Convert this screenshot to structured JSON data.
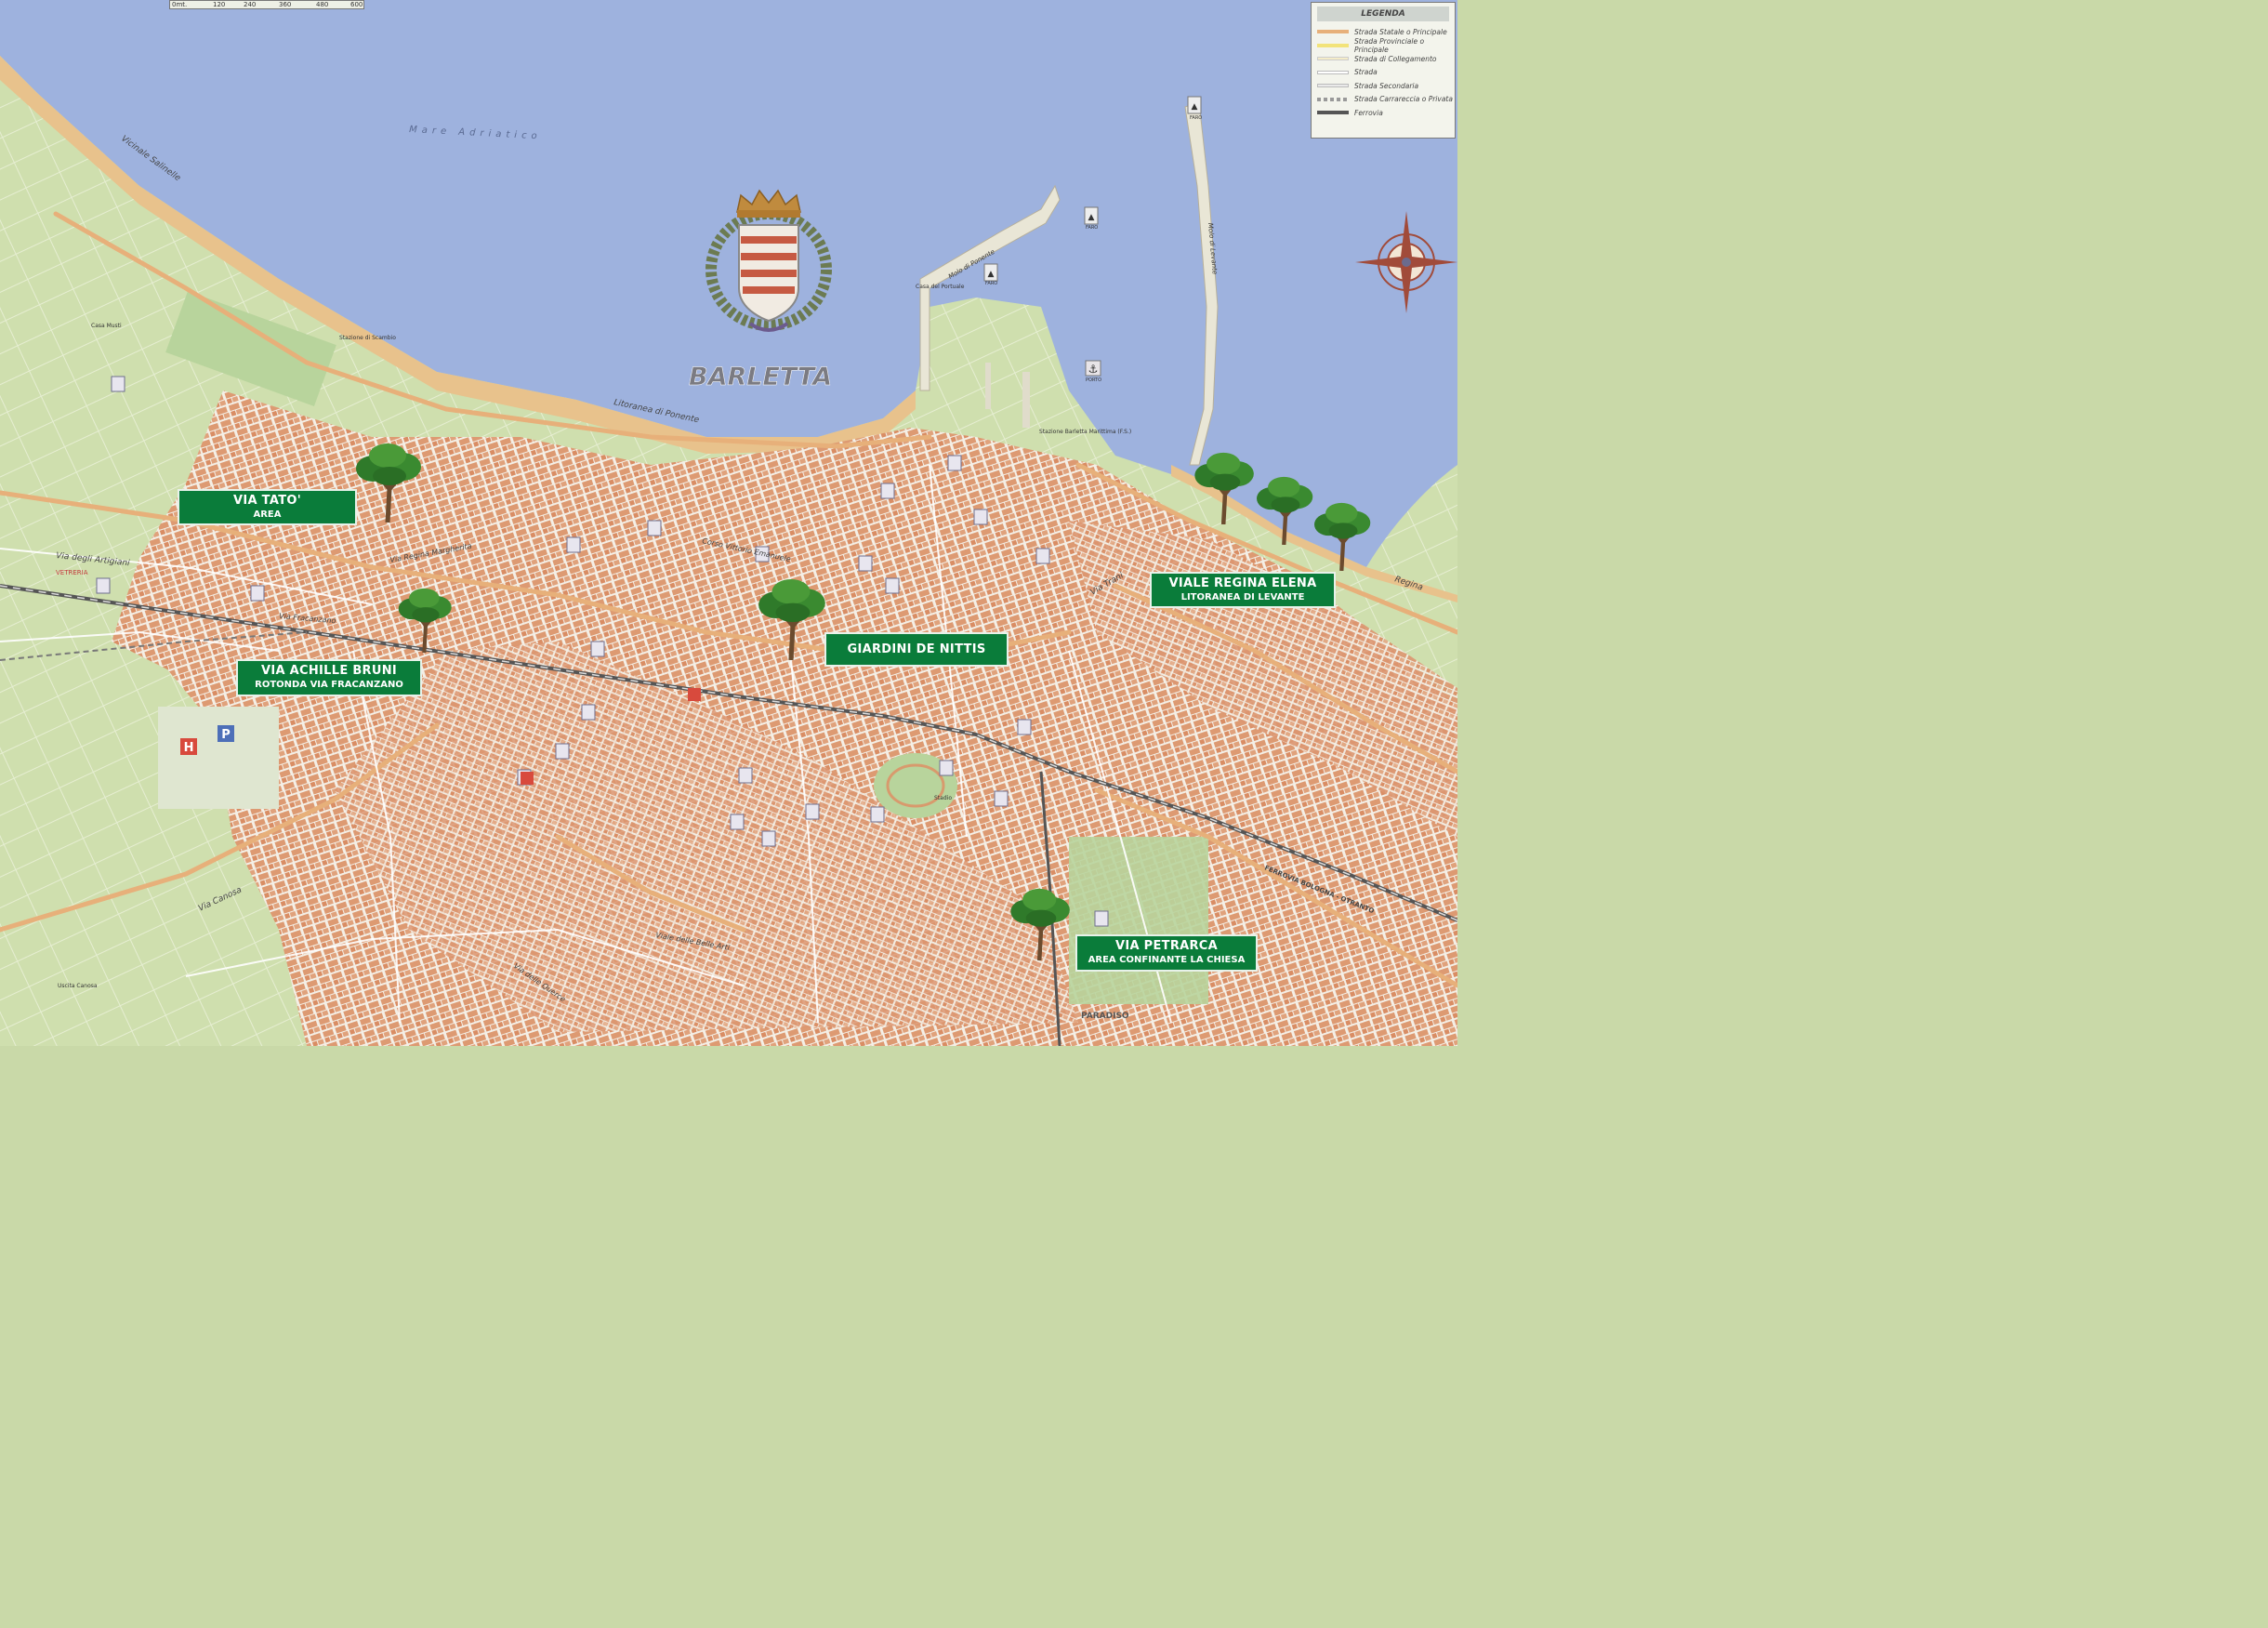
{
  "city_name": "BARLETTA",
  "sea_label": "Mare   Adriatico",
  "scale": {
    "unit": "0mt.",
    "ticks": [
      "120",
      "240",
      "360",
      "480",
      "600"
    ]
  },
  "legend": {
    "title": "LEGENDA",
    "items": [
      {
        "label": "Strada Statale o Principale",
        "color": "#e7b07a"
      },
      {
        "label": "Strada Provinciale o Principale",
        "color": "#f2e37a"
      },
      {
        "label": "Strada di Collegamento",
        "color": "#f4ecc8"
      },
      {
        "label": "Strada",
        "color": "#ffffff"
      },
      {
        "label": "Strada Secondaria",
        "color": "#e9e9e9"
      },
      {
        "label": "Strada Carrareccia o Privata",
        "color": "#bbbbbb"
      },
      {
        "label": "Ferrovia",
        "color": "#555555"
      }
    ]
  },
  "markers": [
    {
      "title": "VIA TATO'",
      "subtitle": "AREA"
    },
    {
      "title": "VIA ACHILLE BRUNI",
      "subtitle": "ROTONDA VIA FRACANZANO"
    },
    {
      "title": "GIARDINI DE NITTIS",
      "subtitle": ""
    },
    {
      "title": "VIALE REGINA ELENA",
      "subtitle": "LITORANEA DI LEVANTE"
    },
    {
      "title": "VIA PETRARCA",
      "subtitle": "AREA CONFINANTE LA CHIESA"
    }
  ],
  "place_labels": {
    "faro1": "FARO",
    "faro2": "FARO",
    "faro3": "FARO",
    "porto": "PORTO",
    "molo_ponente": "Molo di Ponente",
    "molo_levante": "Molo di Levante",
    "casa_portuale": "Casa del Portuale",
    "stazione_marittima": "Stazione Barletta Marittima (F.S.)",
    "litoranea_ponente": "Litoranea di Ponente",
    "vicinale_sabatelle": "Vicinale Salinelle",
    "via_artigianato": "Via degli Artigiani",
    "via_fracanzano": "Via Fracanzano",
    "via_regina_margherita": "Via Regina Margherita",
    "corso_vittorio": "Corso Vittorio Emanuele",
    "ferrovia": "FERROVIA BOLOGNA - OTRANTO",
    "paradiso": "PARADISO",
    "stadio": "Stadio",
    "vetreria": "VETRERIA",
    "via_canosa": "Via Canosa",
    "viale_delle_belle_arti": "Viale delle Belle Arti",
    "via_delle_querce": "Via delle Querce",
    "via_regina": "Regina",
    "via_trani": "Via Trani",
    "stazione_scambio": "Stazione di Scambio",
    "casa_musti": "Casa Musti",
    "uscita_canosa": "Uscita Canosa"
  }
}
